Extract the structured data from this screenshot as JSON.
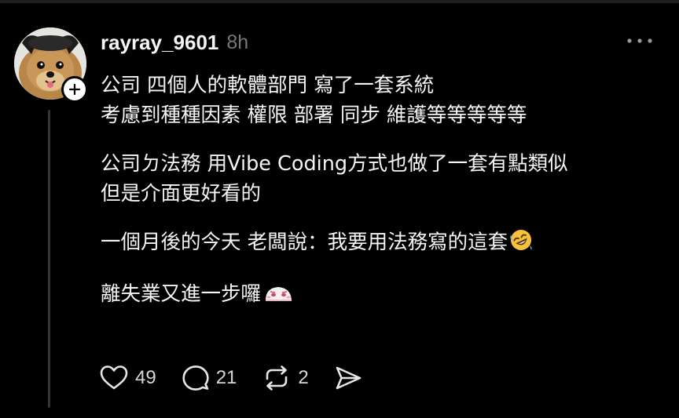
{
  "post": {
    "username": "rayray_9601",
    "timestamp": "8h",
    "body": {
      "para1_line1": "公司 四個人的軟體部門 寫了一套系統",
      "para1_line2": "考慮到種種因素 權限 部署 同步 維護等等等等等",
      "para2_line1": "公司ㄉ法務 用Vibe Coding方式也做了一套有點類似",
      "para2_line2": "但是介面更好看的",
      "para3": "一個月後的今天 老闆說：我要用法務寫的這套",
      "para4": "離失業又進一步囉"
    },
    "emojis": [
      "rolling-on-floor-laughing-emoji",
      "sad-blob-emoji"
    ]
  },
  "actions": {
    "likes": "49",
    "comments": "21",
    "reposts": "2"
  },
  "colors": {
    "background": "#000000",
    "text": "#f3f5f7",
    "muted": "#777777",
    "thread_line": "#333638"
  }
}
